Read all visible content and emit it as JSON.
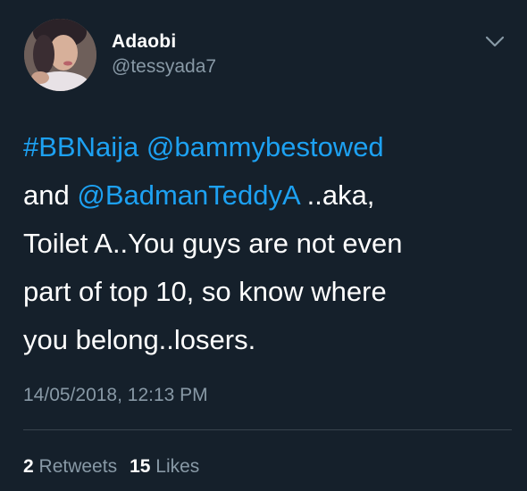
{
  "tweet": {
    "author": {
      "name": "Adaobi",
      "handle": "@tessyada7",
      "avatar_icon": "profile-photo"
    },
    "menu_icon": "chevron-down-icon",
    "text": {
      "hashtag": "#BBNaija",
      "mention1": "@bammybestowed",
      "and": "and",
      "mention2": "@BadmanTeddyA",
      "rest_line2": " ..aka,",
      "line3": "Toilet A..You guys are not even",
      "line4": "part of top 10, so know where",
      "line5": "you belong..losers."
    },
    "timestamp": "14/05/2018, 12:13 PM",
    "stats": {
      "retweets_count": "2",
      "retweets_label": "Retweets",
      "likes_count": "15",
      "likes_label": "Likes"
    },
    "colors": {
      "background": "#15202b",
      "link": "#1da1f2",
      "muted": "#8899a6",
      "text": "#ffffff"
    }
  }
}
